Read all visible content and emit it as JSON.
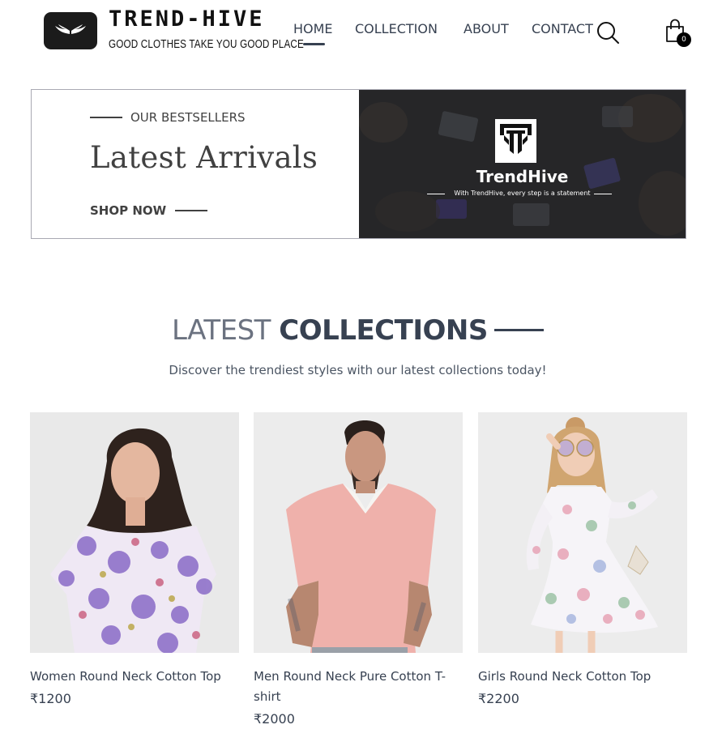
{
  "header": {
    "brand_name": "TREND-HIVE",
    "tagline": "GOOD CLOTHES TAKE YOU GOOD PLACE",
    "nav": [
      {
        "label": "HOME",
        "active": true
      },
      {
        "label": "COLLECTION",
        "active": false
      },
      {
        "label": "ABOUT",
        "active": false
      },
      {
        "label": "CONTACT",
        "active": false
      }
    ],
    "search_icon": "search-icon",
    "cart_icon": "shopping-bag-icon",
    "cart_count": "0"
  },
  "hero": {
    "eyebrow": "OUR BESTSELLERS",
    "title": "Latest Arrivals",
    "cta": "SHOP NOW",
    "banner_brand": "TrendHive",
    "banner_tagline": "With TrendHive, every step is a statement"
  },
  "collections": {
    "title_light": "LATEST",
    "title_bold": "COLLECTIONS",
    "subtitle": "Discover the trendiest styles with our latest collections today!",
    "products": [
      {
        "name": "Women Round Neck Cotton Top",
        "price": "₹1200"
      },
      {
        "name": "Men Round Neck Pure Cotton T-shirt",
        "price": "₹2000"
      },
      {
        "name": "Girls Round Neck Cotton Top",
        "price": "₹2200"
      }
    ]
  },
  "colors": {
    "text": "#374151",
    "muted": "#6b7280",
    "dark": "#1b1b1b",
    "hero_bg": "#23252c"
  }
}
